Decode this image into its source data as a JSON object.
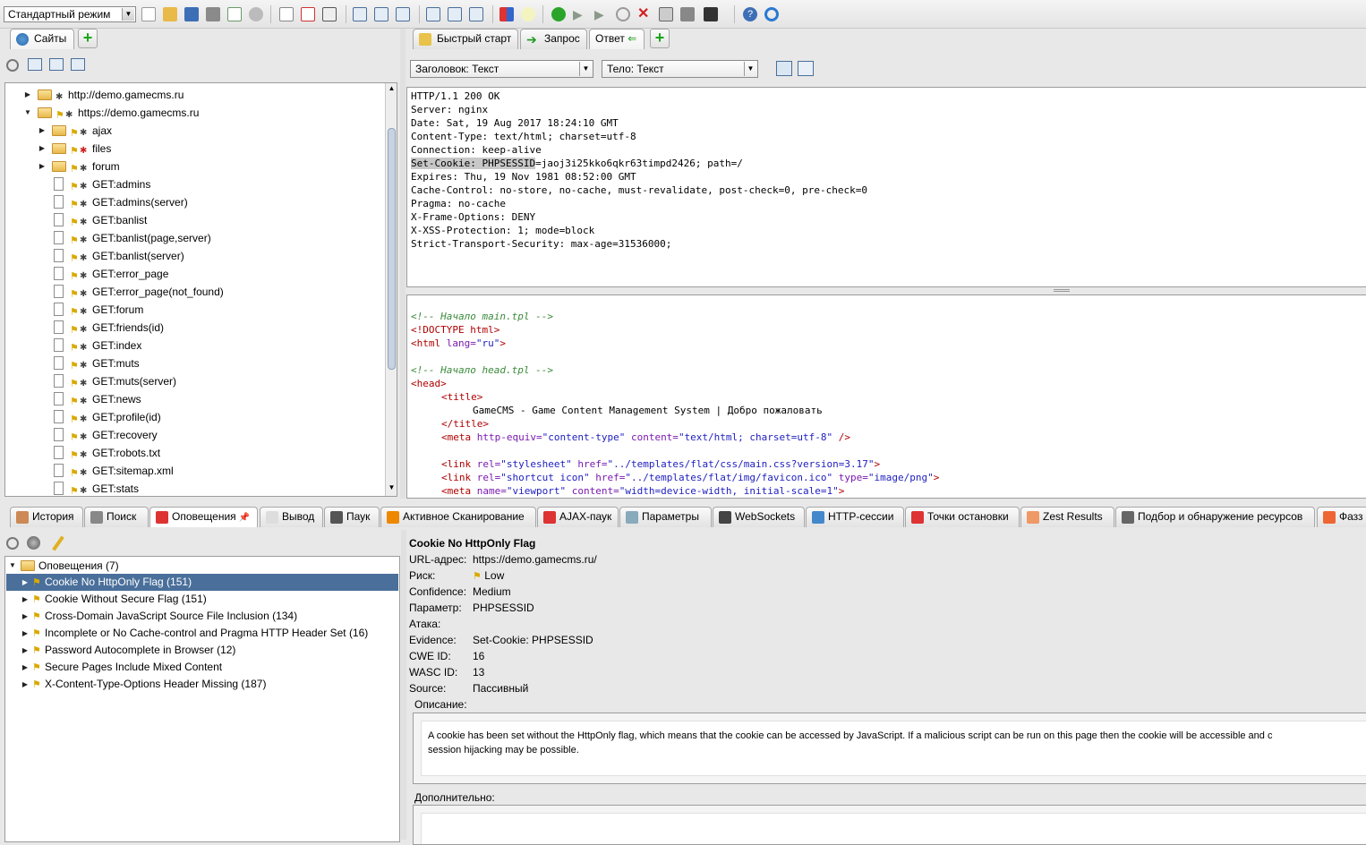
{
  "toolbar": {
    "mode": "Стандартный режим"
  },
  "sites_panel": {
    "tab_label": "Сайты",
    "tree": [
      {
        "label": "http://demo.gamecms.ru",
        "kind": "folder",
        "level": 0,
        "expanded": false
      },
      {
        "label": "https://demo.gamecms.ru",
        "kind": "folder",
        "level": 0,
        "expanded": true
      },
      {
        "label": "ajax",
        "kind": "folder",
        "level": 1,
        "expanded": false
      },
      {
        "label": "files",
        "kind": "folder",
        "level": 1,
        "expanded": false,
        "alert": "red"
      },
      {
        "label": "forum",
        "kind": "folder",
        "level": 1,
        "expanded": false
      },
      {
        "label": "GET:admins",
        "kind": "doc",
        "level": 1
      },
      {
        "label": "GET:admins(server)",
        "kind": "doc",
        "level": 1
      },
      {
        "label": "GET:banlist",
        "kind": "doc",
        "level": 1
      },
      {
        "label": "GET:banlist(page,server)",
        "kind": "doc",
        "level": 1
      },
      {
        "label": "GET:banlist(server)",
        "kind": "doc",
        "level": 1
      },
      {
        "label": "GET:error_page",
        "kind": "doc",
        "level": 1
      },
      {
        "label": "GET:error_page(not_found)",
        "kind": "doc",
        "level": 1
      },
      {
        "label": "GET:forum",
        "kind": "doc",
        "level": 1
      },
      {
        "label": "GET:friends(id)",
        "kind": "doc",
        "level": 1
      },
      {
        "label": "GET:index",
        "kind": "doc",
        "level": 1
      },
      {
        "label": "GET:muts",
        "kind": "doc",
        "level": 1
      },
      {
        "label": "GET:muts(server)",
        "kind": "doc",
        "level": 1
      },
      {
        "label": "GET:news",
        "kind": "doc",
        "level": 1
      },
      {
        "label": "GET:profile(id)",
        "kind": "doc",
        "level": 1
      },
      {
        "label": "GET:recovery",
        "kind": "doc",
        "level": 1
      },
      {
        "label": "GET:robots.txt",
        "kind": "doc",
        "level": 1
      },
      {
        "label": "GET:sitemap.xml",
        "kind": "doc",
        "level": 1
      },
      {
        "label": "GET:stats",
        "kind": "doc",
        "level": 1
      }
    ]
  },
  "work_tabs": {
    "quick_start": "Быстрый старт",
    "request": "Запрос",
    "response": "Ответ"
  },
  "response": {
    "header_combo": "Заголовок: Текст",
    "body_combo": "Тело: Текст",
    "header_lines": [
      "HTTP/1.1 200 OK",
      "Server: nginx",
      "Date: Sat, 19 Aug 2017 18:24:10 GMT",
      "Content-Type: text/html; charset=utf-8",
      "Connection: keep-alive",
      "Set-Cookie: PHPSESSID=jaoj3i25kko6qkr63timpd2426; path=/",
      "Expires: Thu, 19 Nov 1981 08:52:00 GMT",
      "Cache-Control: no-store, no-cache, must-revalidate, post-check=0, pre-check=0",
      "Pragma: no-cache",
      "X-Frame-Options: DENY",
      "X-XSS-Protection: 1; mode=block",
      "Strict-Transport-Security: max-age=31536000;"
    ],
    "highlight": "Set-Cookie: PHPSESSID",
    "body": {
      "c1": "<!-- Начало main.tpl -->",
      "doctype": "<!DOCTYPE html>",
      "html_open": "<html",
      "html_attr": " lang=",
      "html_val": "\"ru\"",
      "gt": ">",
      "c2": "<!-- Начало head.tpl -->",
      "head_open": "<head>",
      "title_open": "<title>",
      "title_text": "GameCMS - Game Content Management System | Добро пожаловать",
      "title_close": "</title>",
      "meta_open": "<meta",
      "meta1_attr1": " http-equiv=",
      "meta1_val1": "\"content-type\"",
      "meta1_attr2": " content=",
      "meta1_val2": "\"text/html; charset=utf-8\"",
      "self_close": " />",
      "link_open": "<link",
      "link1_attr1": " rel=",
      "link1_val1": "\"stylesheet\"",
      "link1_attr2": " href=",
      "link1_val2": "\"../templates/flat/css/main.css?version=3.17\"",
      "link2_val1": "\"shortcut icon\"",
      "link2_val2": "\"../templates/flat/img/favicon.ico\"",
      "link2_attr3": " type=",
      "link2_val3": "\"image/png\"",
      "meta2_attr1": " name=",
      "meta2_val1": "\"viewport\"",
      "meta2_attr2": " content=",
      "meta2_val2": "\"width=device-width, initial-scale=1\""
    }
  },
  "bottom_tabs": [
    "История",
    "Поиск",
    "Оповещения",
    "Вывод",
    "Паук",
    "Активное Сканирование",
    "AJAX-паук",
    "Параметры",
    "WebSockets",
    "HTTP-сессии",
    "Точки остановки",
    "Zest Results",
    "Подбор и обнаружение ресурсов",
    "Фазз"
  ],
  "alerts": {
    "root": "Оповещения (7)",
    "items": [
      "Cookie No HttpOnly Flag (151)",
      "Cookie Without Secure Flag (151)",
      "Cross-Domain JavaScript Source File Inclusion (134)",
      "Incomplete or No Cache-control and Pragma HTTP Header Set (16)",
      "Password Autocomplete in Browser (12)",
      "Secure Pages Include Mixed Content",
      "X-Content-Type-Options Header Missing (187)"
    ]
  },
  "detail": {
    "title": "Cookie No HttpOnly Flag",
    "rows": [
      {
        "k": "URL-адрес:",
        "v": "https://demo.gamecms.ru/"
      },
      {
        "k": "Риск:",
        "v": "Low"
      },
      {
        "k": "Confidence:",
        "v": "Medium"
      },
      {
        "k": "Параметр:",
        "v": "PHPSESSID"
      },
      {
        "k": "Атака:",
        "v": ""
      },
      {
        "k": "Evidence:",
        "v": "Set-Cookie: PHPSESSID"
      },
      {
        "k": "CWE ID:",
        "v": "16"
      },
      {
        "k": "WASC ID:",
        "v": "13"
      },
      {
        "k": "Source:",
        "v": "Пассивный"
      }
    ],
    "desc_label": "Описание:",
    "desc_line1": "A cookie has been set without the HttpOnly flag, which means that the cookie can be accessed by JavaScript. If a malicious script can be run on this page then the cookie will be accessible and c",
    "desc_line2": "session hijacking may be possible.",
    "extra_label": "Дополнительно:"
  },
  "colors": {
    "selection": "#4a6f9a",
    "flag": "#d9a900",
    "add": "#19a619"
  }
}
